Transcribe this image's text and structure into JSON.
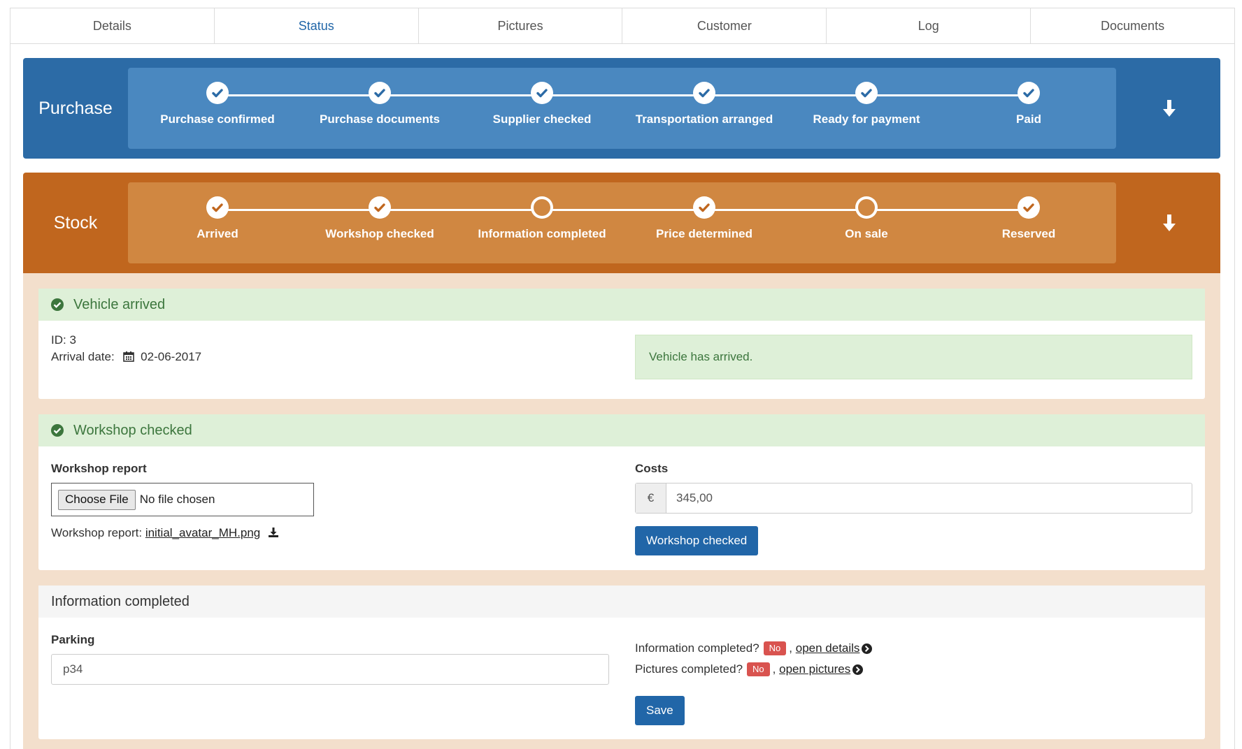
{
  "tabs": [
    {
      "label": "Details"
    },
    {
      "label": "Status"
    },
    {
      "label": "Pictures"
    },
    {
      "label": "Customer"
    },
    {
      "label": "Log"
    },
    {
      "label": "Documents"
    }
  ],
  "active_tab": "Status",
  "purchase": {
    "title": "Purchase",
    "color": "#2c6ba6",
    "steps": [
      {
        "label": "Purchase confirmed",
        "done": true
      },
      {
        "label": "Purchase documents",
        "done": true
      },
      {
        "label": "Supplier checked",
        "done": true
      },
      {
        "label": "Transportation arranged",
        "done": true
      },
      {
        "label": "Ready for payment",
        "done": true
      },
      {
        "label": "Paid",
        "done": true
      }
    ]
  },
  "stock": {
    "title": "Stock",
    "color": "#c0661e",
    "steps": [
      {
        "label": "Arrived",
        "done": true
      },
      {
        "label": "Workshop checked",
        "done": true
      },
      {
        "label": "Information completed",
        "done": false
      },
      {
        "label": "Price determined",
        "done": true
      },
      {
        "label": "On sale",
        "done": false
      },
      {
        "label": "Reserved",
        "done": true
      }
    ]
  },
  "vehicle_arrived": {
    "header": "Vehicle arrived",
    "id_line": "ID: 3",
    "arrival_label": "Arrival date:",
    "arrival_date": "02-06-2017",
    "message": "Vehicle has arrived."
  },
  "workshop": {
    "header": "Workshop checked",
    "report_label": "Workshop report",
    "choose_file": "Choose File",
    "no_file": "No file chosen",
    "report_prefix": "Workshop report:",
    "report_file": "initial_avatar_MH.png",
    "costs_label": "Costs",
    "currency": "€",
    "costs_value": "345,00",
    "button": "Workshop checked"
  },
  "information": {
    "header": "Information completed",
    "parking_label": "Parking",
    "parking_value": "p34",
    "info_q": "Information completed?",
    "info_badge": "No",
    "info_sep": ",",
    "info_link": "open details",
    "pics_q": "Pictures completed?",
    "pics_badge": "No",
    "pics_sep": ",",
    "pics_link": "open pictures",
    "save": "Save"
  },
  "icons": {
    "step_done": "check-circle-icon",
    "step_open": "empty-circle-icon",
    "toggle": "arrow-down-icon",
    "panel_ok": "check-circle-icon",
    "calendar": "calendar-icon",
    "download": "download-icon",
    "link_arrow": "arrow-circle-right-icon"
  },
  "colors": {
    "primary": "#2166a8",
    "success_bg": "#def0d8",
    "success_text": "#3c763d",
    "danger": "#d9534f",
    "stock_bg": "#f3dfcc"
  }
}
